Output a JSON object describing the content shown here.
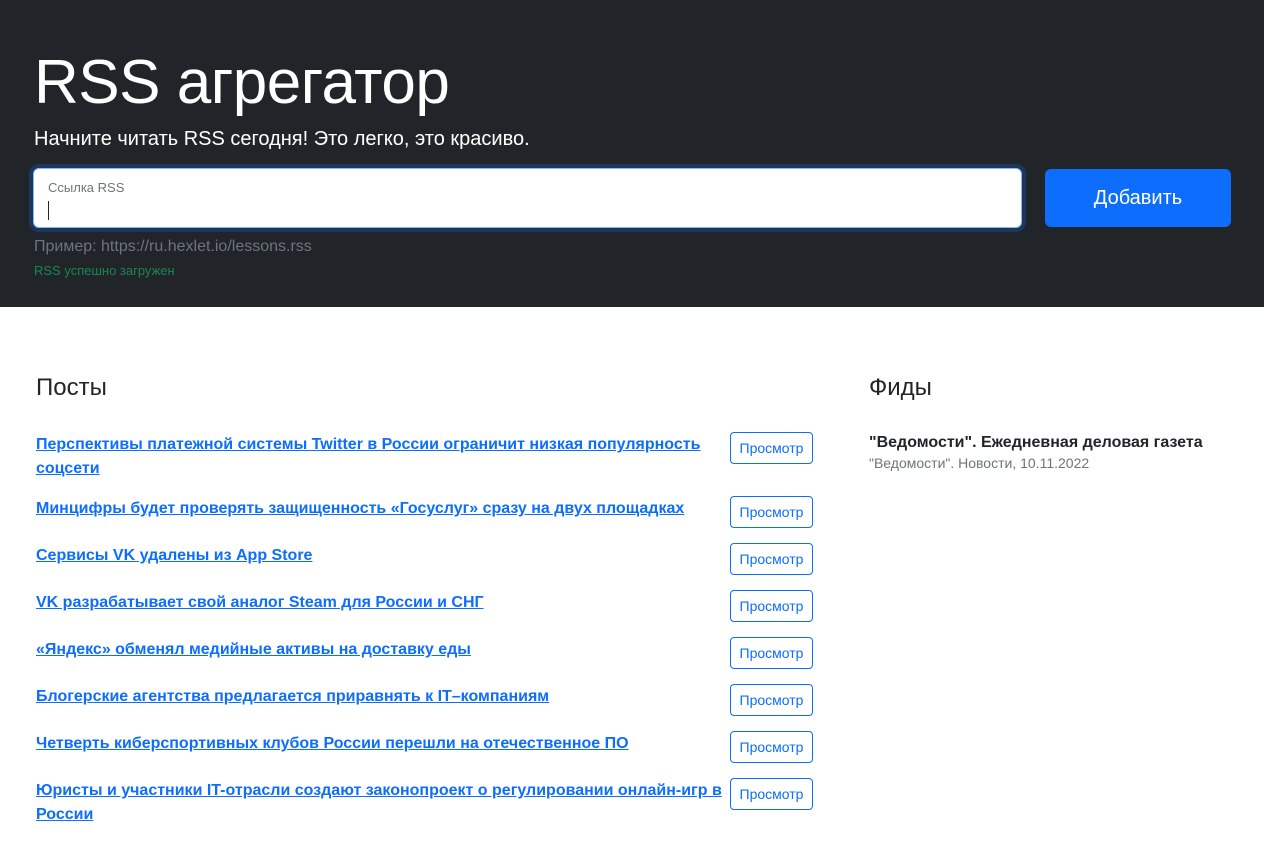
{
  "app": {
    "title": "RSS агрегатор",
    "lead": "Начните читать RSS сегодня! Это легко, это красиво."
  },
  "form": {
    "field_label": "Ссылка RSS",
    "field_value": "",
    "add_label": "Добавить",
    "example": "Пример: https://ru.hexlet.io/lessons.rss",
    "feedback": "RSS успешно загружен"
  },
  "posts": {
    "title": "Посты",
    "view_label": "Просмотр",
    "items": [
      "Перспективы платежной системы Twitter в России ограничит низкая популярность соцсети",
      "Минцифры будет проверять защищенность «Госуслуг» сразу на двух площадках",
      "Сервисы VK удалены из App Store",
      "VK разрабатывает свой аналог Steam для России и СНГ",
      "«Яндекс» обменял медийные активы на доставку еды",
      "Блогерские агентства предлагается приравнять к IT–компаниям",
      "Четверть киберспортивных клубов России перешли на отечественное ПО",
      "Юристы и участники IT-отрасли создают законопроект о регулировании онлайн-игр в России"
    ]
  },
  "feeds": {
    "title": "Фиды",
    "items": [
      {
        "name": "\"Ведомости\". Ежедневная деловая газета",
        "description": "\"Ведомости\". Новости, 10.11.2022"
      }
    ]
  },
  "colors": {
    "hero_bg": "#212529",
    "primary": "#0d6efd",
    "success": "#198754",
    "muted": "#6c757d"
  }
}
